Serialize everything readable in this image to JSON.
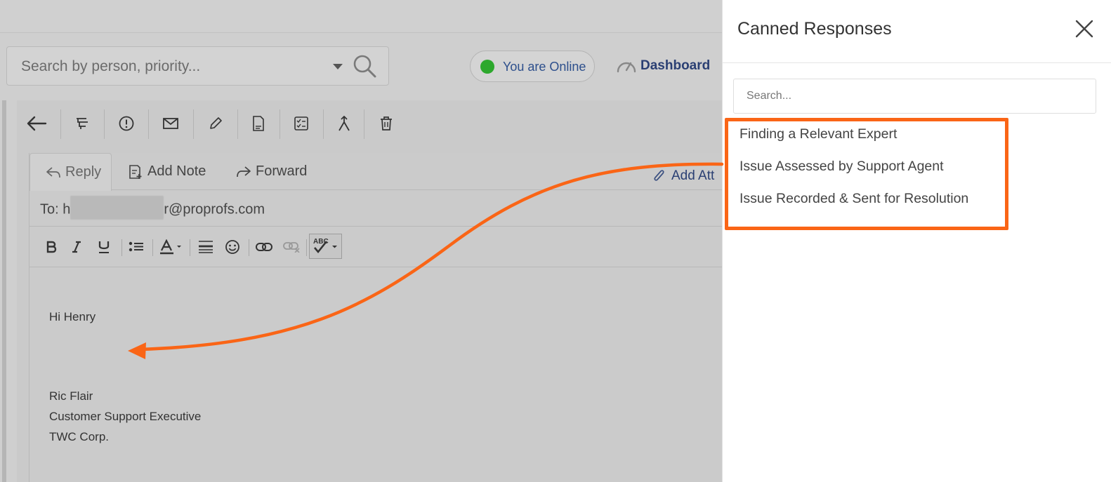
{
  "search": {
    "placeholder": "Search by person, priority..."
  },
  "status": {
    "label": "You are Online",
    "dot_color": "#2da82d"
  },
  "nav": {
    "dashboard_label": "Dashboard"
  },
  "toolbar": {
    "icons": [
      "back-arrow-icon",
      "assign-icon",
      "priority-icon",
      "mail-icon",
      "edit-icon",
      "pdf-icon",
      "checklist-icon",
      "merge-icon",
      "trash-icon"
    ]
  },
  "compose": {
    "tabs": [
      {
        "label": "Reply",
        "active": true
      },
      {
        "label": "Add Note",
        "active": false
      },
      {
        "label": "Forward",
        "active": false
      }
    ],
    "add_attachment_label": "Add Att",
    "to_prefix": "To: h",
    "to_suffix": "r@proprofs.com",
    "body": {
      "greeting": "Hi Henry",
      "signature_name": "Ric Flair",
      "signature_title": "Customer Support Executive",
      "signature_company": "TWC Corp."
    }
  },
  "canned": {
    "title": "Canned Responses",
    "search_placeholder": "Search...",
    "items": [
      "Finding a Relevant Expert",
      "Issue Assessed by Support Agent",
      "Issue Recorded & Sent for Resolution"
    ]
  },
  "annotation": {
    "color": "#fa6516"
  }
}
